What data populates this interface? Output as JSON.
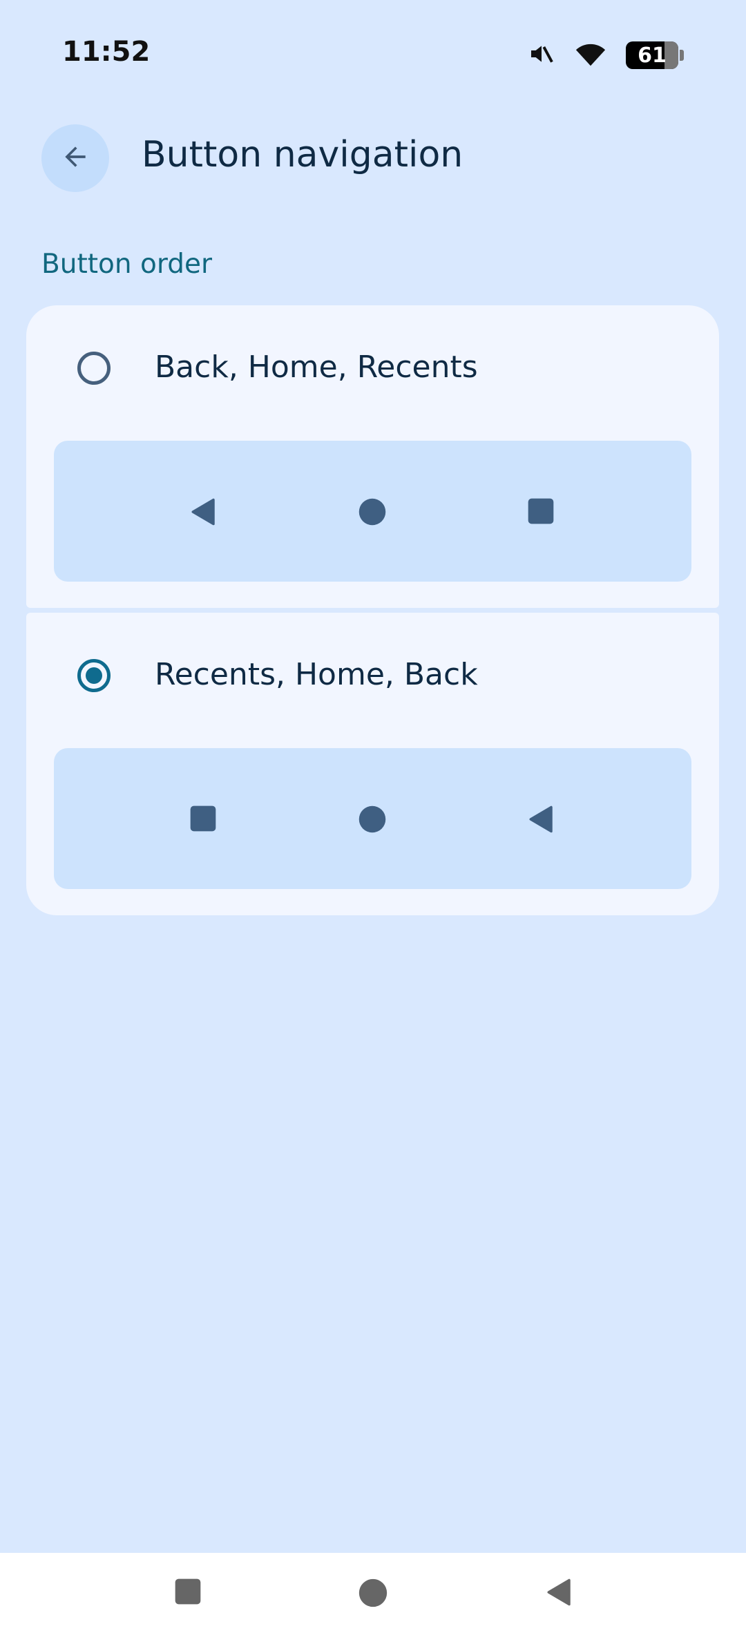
{
  "status_bar": {
    "time": "11:52",
    "battery_level": "61",
    "icons": [
      "mute-icon",
      "wifi-icon",
      "battery-icon"
    ]
  },
  "app_bar": {
    "back_icon": "arrow-back-icon",
    "title": "Button navigation"
  },
  "section": {
    "title": "Button order"
  },
  "options": [
    {
      "label": "Back, Home, Recents",
      "selected": false,
      "preview_icons": [
        "back-triangle-icon",
        "home-circle-icon",
        "recents-square-icon"
      ]
    },
    {
      "label": "Recents, Home, Back",
      "selected": true,
      "preview_icons": [
        "recents-square-icon",
        "home-circle-icon",
        "back-triangle-icon"
      ]
    }
  ],
  "system_nav": {
    "icons": [
      "recents-square-icon",
      "home-circle-icon",
      "back-triangle-icon"
    ]
  },
  "colors": {
    "background": "#d9e8fe",
    "card": "#f2f6ff",
    "preview": "#cde3fd",
    "accent": "#0f6b8e",
    "icon": "#46607d"
  }
}
